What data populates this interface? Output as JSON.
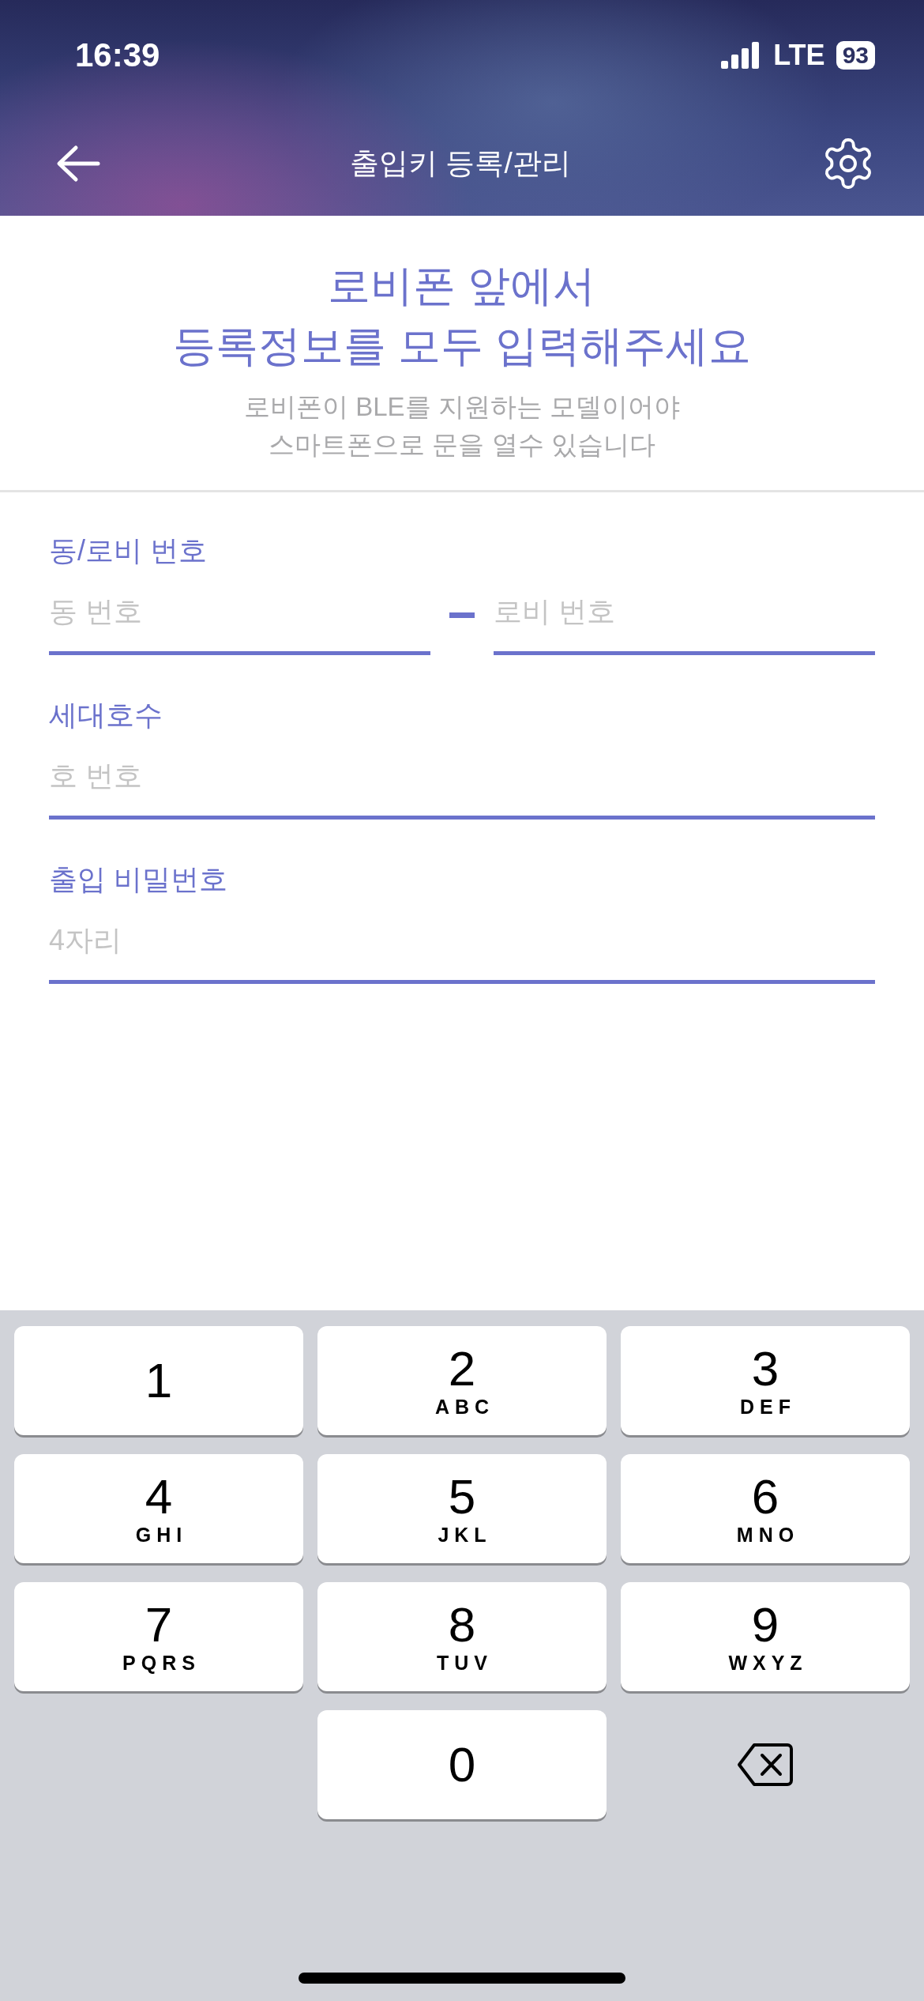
{
  "status_bar": {
    "time": "16:39",
    "network": "LTE",
    "battery": "93"
  },
  "nav": {
    "title": "출입키 등록/관리"
  },
  "intro": {
    "headline": [
      "로비폰 앞에서",
      "등록정보를 모두 입력해주세요"
    ],
    "note": [
      "로비폰이 BLE를 지원하는 모델이어야",
      "스마트폰으로 문을 열수 있습니다"
    ]
  },
  "fields": [
    {
      "label": "동/로비 번호",
      "inputs": [
        {
          "placeholder": "동 번호"
        },
        {
          "placeholder": "로비 번호"
        }
      ]
    },
    {
      "label": "세대호수",
      "inputs": [
        {
          "placeholder": "호 번호"
        }
      ]
    },
    {
      "label": "출입 비밀번호",
      "inputs": [
        {
          "placeholder": "4자리"
        }
      ]
    }
  ],
  "keypad": [
    {
      "kind": "digit",
      "digit": "1"
    },
    {
      "kind": "digit",
      "digit": "2",
      "letters": "ABC"
    },
    {
      "kind": "digit",
      "digit": "3",
      "letters": "DEF"
    },
    {
      "kind": "digit",
      "digit": "4",
      "letters": "GHI"
    },
    {
      "kind": "digit",
      "digit": "5",
      "letters": "JKL"
    },
    {
      "kind": "digit",
      "digit": "6",
      "letters": "MNO"
    },
    {
      "kind": "digit",
      "digit": "7",
      "letters": "PQRS"
    },
    {
      "kind": "digit",
      "digit": "8",
      "letters": "TUV"
    },
    {
      "kind": "digit",
      "digit": "9",
      "letters": "WXYZ"
    },
    {
      "kind": "digit",
      "digit": "0"
    },
    {
      "kind": "delete"
    }
  ]
}
